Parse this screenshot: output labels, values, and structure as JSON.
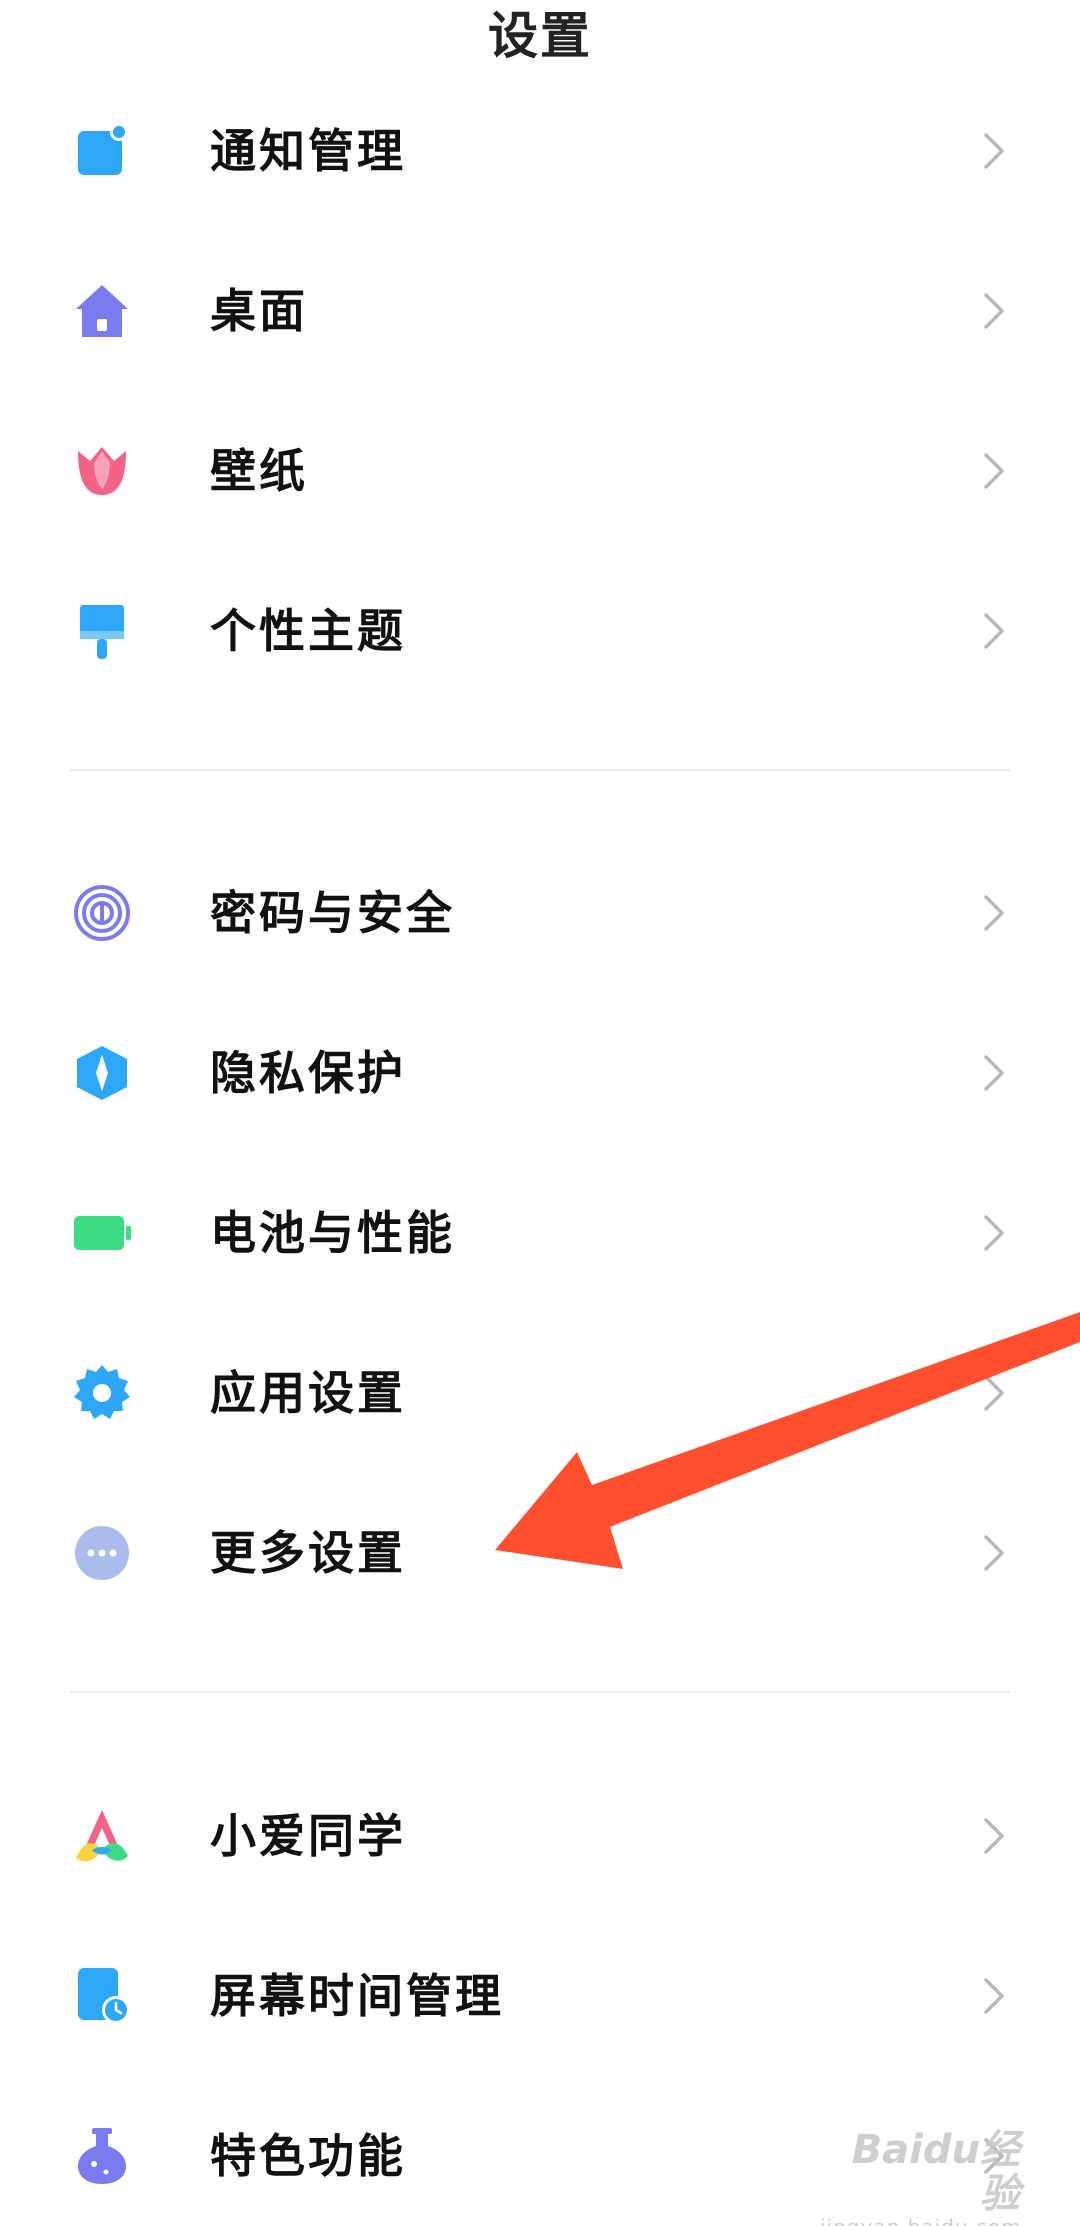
{
  "header": {
    "title": "设置"
  },
  "groups": [
    {
      "items": [
        {
          "label": "通知管理",
          "icon": "notification-icon",
          "color": "#2EA7F8"
        },
        {
          "label": "桌面",
          "icon": "home-icon",
          "color": "#7B7BF0"
        },
        {
          "label": "壁纸",
          "icon": "tulip-icon",
          "color": "#F36388"
        },
        {
          "label": "个性主题",
          "icon": "brush-icon",
          "color": "#2EA7F8"
        }
      ]
    },
    {
      "items": [
        {
          "label": "密码与安全",
          "icon": "fingerprint-icon",
          "color": "#7B7BF0"
        },
        {
          "label": "隐私保护",
          "icon": "privacy-shield-icon",
          "color": "#2EA7F8"
        },
        {
          "label": "电池与性能",
          "icon": "battery-icon",
          "color": "#3DDC84"
        },
        {
          "label": "应用设置",
          "icon": "gear-icon",
          "color": "#2EA7F8"
        },
        {
          "label": "更多设置",
          "icon": "more-dots-icon",
          "color": "#A9BCEB"
        }
      ]
    },
    {
      "items": [
        {
          "label": "小爱同学",
          "icon": "xiaoai-icon",
          "color": "#F36388"
        },
        {
          "label": "屏幕时间管理",
          "icon": "screen-time-icon",
          "color": "#2EA7F8"
        },
        {
          "label": "特色功能",
          "icon": "flask-icon",
          "color": "#7B7BF0"
        }
      ]
    }
  ],
  "annotation": {
    "arrow_color": "#FF4F2E"
  },
  "watermark": {
    "main": "Baidu经验",
    "sub": "jingyan.baidu.com"
  }
}
